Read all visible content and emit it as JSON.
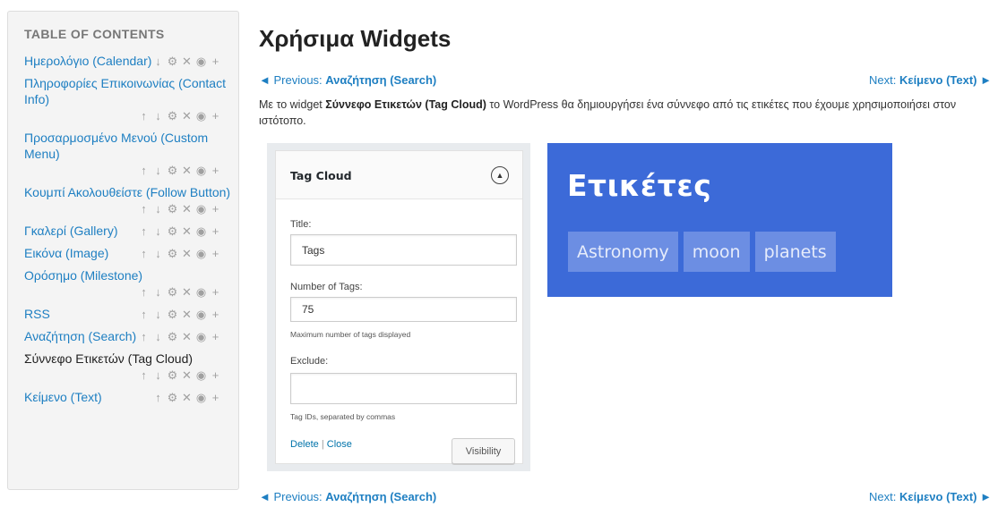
{
  "toc": {
    "heading": "TABLE OF CONTENTS",
    "items": [
      {
        "label": "Ημερολόγιο (Calendar)",
        "actions": [
          "down",
          "gear",
          "close",
          "eye",
          "add"
        ],
        "active": false
      },
      {
        "label": "Πληροφορίες Επικοινωνίας (Contact Info)",
        "actions": [
          "up",
          "down",
          "gear",
          "close",
          "eye",
          "add"
        ],
        "active": false
      },
      {
        "label": "Προσαρμοσμένο Μενού (Custom Menu)",
        "actions": [
          "up",
          "down",
          "gear",
          "close",
          "eye",
          "add"
        ],
        "active": false
      },
      {
        "label": "Κουμπί Ακολουθείστε (Follow Button)",
        "actions": [
          "up",
          "down",
          "gear",
          "close",
          "eye",
          "add"
        ],
        "active": false
      },
      {
        "label": "Γκαλερί (Gallery)",
        "actions": [
          "up",
          "down",
          "gear",
          "close",
          "eye",
          "add"
        ],
        "active": false
      },
      {
        "label": "Εικόνα (Image)",
        "actions": [
          "up",
          "down",
          "gear",
          "close",
          "eye",
          "add"
        ],
        "active": false
      },
      {
        "label": "Ορόσημο (Milestone)",
        "actions": [
          "up",
          "down",
          "gear",
          "close",
          "eye",
          "add"
        ],
        "active": false
      },
      {
        "label": "RSS",
        "actions": [
          "up",
          "down",
          "gear",
          "close",
          "eye",
          "add"
        ],
        "active": false
      },
      {
        "label": "Αναζήτηση (Search)",
        "actions": [
          "up",
          "down",
          "gear",
          "close",
          "eye",
          "add"
        ],
        "active": false
      },
      {
        "label": "Σύννεφο Ετικετών (Tag Cloud)",
        "actions": [
          "up",
          "down",
          "gear",
          "close",
          "eye",
          "add"
        ],
        "active": true
      },
      {
        "label": "Κείμενο (Text)",
        "actions": [
          "up",
          "gear",
          "close",
          "eye",
          "add"
        ],
        "active": false
      }
    ]
  },
  "page": {
    "title": "Χρήσιμα Widgets",
    "nav": {
      "prev_prefix": "◄ Previous: ",
      "prev_title": "Αναζήτηση (Search)",
      "next_prefix": "Next: ",
      "next_title": "Κείμενο (Text) ►"
    },
    "intro_before": "Με το widget ",
    "intro_bold": "Σύννεφο Ετικετών (Tag Cloud)",
    "intro_after": " το WordPress θα δημιουργήσει ένα σύννεφο από τις ετικέτες που έχουμε χρησιμοποιήσει στον ιστότοπο."
  },
  "widget": {
    "title": "Tag Cloud",
    "title_label": "Title:",
    "title_value": "Tags",
    "number_label": "Number of Tags:",
    "number_value": "75",
    "number_help": "Maximum number of tags displayed",
    "exclude_label": "Exclude:",
    "exclude_value": "",
    "exclude_help": "Tag IDs, separated by commas",
    "delete_link": "Delete",
    "separator": "|",
    "close_link": "Close",
    "visibility_button": "Visibility"
  },
  "cloud_preview": {
    "heading": "Ετικέτες",
    "tags": [
      "Astronomy",
      "moon",
      "planets"
    ],
    "background": "#3c6ad8",
    "tag_background": "#6c8ee3"
  },
  "icons": {
    "up": "↑",
    "down": "↓",
    "gear": "⚙",
    "close": "✕",
    "eye": "◉",
    "add": "+"
  },
  "colors": {
    "link": "#1e7fc2",
    "wp_link": "#0073aa"
  }
}
